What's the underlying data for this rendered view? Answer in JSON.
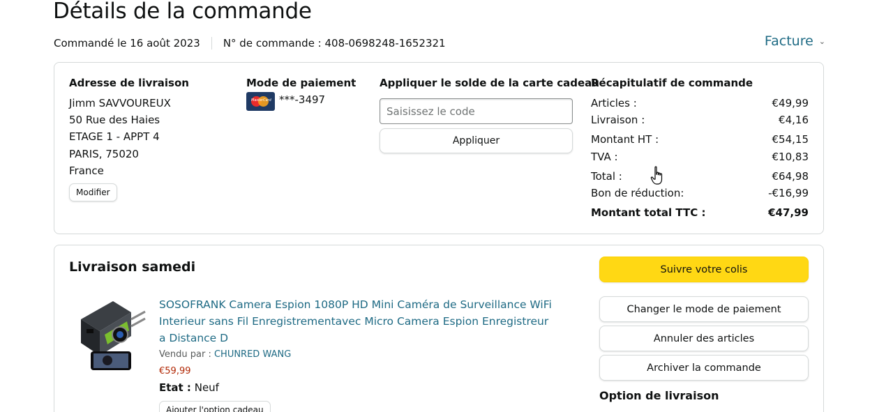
{
  "page": {
    "title": "Détails de la commande",
    "ordered_on": "Commandé le 16 août 2023",
    "order_number": "N° de commande : 408-0698248-1652321",
    "invoice_label": "Facture"
  },
  "address": {
    "title": "Adresse de livraison",
    "lines": [
      "Jimm SAVVOUREUX",
      "50 Rue des Haies",
      "ETAGE 1 - APPT 4",
      "PARIS, 75020",
      "France"
    ],
    "modify_label": "Modifier"
  },
  "payment": {
    "title": "Mode de paiement",
    "card_icon": "mastercard-icon",
    "card_brand_text": "MasterCard",
    "card_number": "***-3497"
  },
  "gift_card": {
    "title": "Appliquer le solde de la carte cadeau",
    "placeholder": "Saisissez le code",
    "apply_label": "Appliquer"
  },
  "order_summary": {
    "title": "Récapitulatif de commande",
    "rows": [
      {
        "label": "Articles :",
        "value": "€49,99"
      },
      {
        "label": "Livraison :",
        "value": "€4,16"
      },
      {
        "label": "Montant HT :",
        "value": "€54,15"
      },
      {
        "label": "TVA :",
        "value": "€10,83"
      },
      {
        "label": "Total :",
        "value": "€64,98"
      },
      {
        "label": "Bon de réduction:",
        "value": "-€16,99"
      },
      {
        "label": "Montant total TTC :",
        "value": "€47,99"
      }
    ]
  },
  "shipment": {
    "title": "Livraison samedi",
    "product": {
      "title": "SOSOFRANK Camera Espion 1080P HD Mini Caméra de Surveillance WiFi Interieur sans Fil Enregistrementavec Micro Camera Espion Enregistreur a Distance D",
      "sold_by_label": "Vendu par :",
      "seller": "CHUNRED WANG",
      "price": "€59,99",
      "condition_label": "Etat :",
      "condition_value": "Neuf",
      "gift_option_label": "Ajouter l'option cadeau"
    },
    "actions": {
      "track": "Suivre votre colis",
      "change_payment": "Changer le mode de paiement",
      "cancel_items": "Annuler des articles",
      "archive": "Archiver la commande"
    },
    "delivery_option_title": "Option de livraison"
  },
  "colors": {
    "link": "#1e6a84",
    "primary_button": "#ffd814",
    "price": "#b12704",
    "border": "#d5d9d9"
  }
}
